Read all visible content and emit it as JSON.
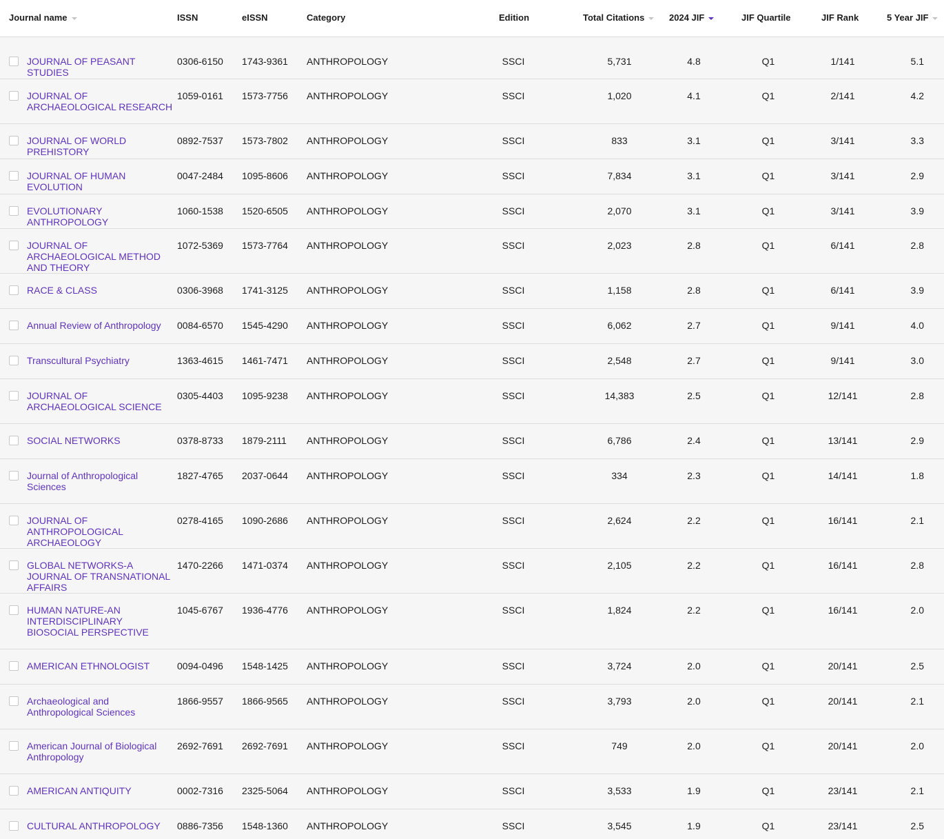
{
  "headers": {
    "journal_name": "Journal name",
    "issn": "ISSN",
    "eissn": "eISSN",
    "category": "Category",
    "edition": "Edition",
    "total_citations": "Total Citations",
    "jif": "2024 JIF",
    "jif_quartile": "JIF Quartile",
    "jif_rank": "JIF Rank",
    "five_year_jif": "5 Year JIF"
  },
  "colors": {
    "link": "#5e33bf",
    "active_sort": "#5e33bf",
    "row_bg": "#f6f6f6",
    "header_bg": "#ffffff",
    "divider": "#dcdcdc"
  },
  "rows": [
    {
      "name": "JOURNAL OF PEASANT STUDIES",
      "issn": "0306-6150",
      "eissn": "1743-9361",
      "category": "ANTHROPOLOGY",
      "edition": "SSCI",
      "citations": "5,731",
      "jif": "4.8",
      "quartile": "Q1",
      "rank": "1/141",
      "jif5": "5.1"
    },
    {
      "name": "JOURNAL OF ARCHAEOLOGICAL RESEARCH",
      "issn": "1059-0161",
      "eissn": "1573-7756",
      "category": "ANTHROPOLOGY",
      "edition": "SSCI",
      "citations": "1,020",
      "jif": "4.1",
      "quartile": "Q1",
      "rank": "2/141",
      "jif5": "4.2"
    },
    {
      "name": "JOURNAL OF WORLD PREHISTORY",
      "issn": "0892-7537",
      "eissn": "1573-7802",
      "category": "ANTHROPOLOGY",
      "edition": "SSCI",
      "citations": "833",
      "jif": "3.1",
      "quartile": "Q1",
      "rank": "3/141",
      "jif5": "3.3"
    },
    {
      "name": "JOURNAL OF HUMAN EVOLUTION",
      "issn": "0047-2484",
      "eissn": "1095-8606",
      "category": "ANTHROPOLOGY",
      "edition": "SSCI",
      "citations": "7,834",
      "jif": "3.1",
      "quartile": "Q1",
      "rank": "3/141",
      "jif5": "2.9"
    },
    {
      "name": "EVOLUTIONARY ANTHROPOLOGY",
      "issn": "1060-1538",
      "eissn": "1520-6505",
      "category": "ANTHROPOLOGY",
      "edition": "SSCI",
      "citations": "2,070",
      "jif": "3.1",
      "quartile": "Q1",
      "rank": "3/141",
      "jif5": "3.9"
    },
    {
      "name": "JOURNAL OF ARCHAEOLOGICAL METHOD AND THEORY",
      "issn": "1072-5369",
      "eissn": "1573-7764",
      "category": "ANTHROPOLOGY",
      "edition": "SSCI",
      "citations": "2,023",
      "jif": "2.8",
      "quartile": "Q1",
      "rank": "6/141",
      "jif5": "2.8"
    },
    {
      "name": "RACE & CLASS",
      "issn": "0306-3968",
      "eissn": "1741-3125",
      "category": "ANTHROPOLOGY",
      "edition": "SSCI",
      "citations": "1,158",
      "jif": "2.8",
      "quartile": "Q1",
      "rank": "6/141",
      "jif5": "3.9"
    },
    {
      "name": "Annual Review of Anthropology",
      "issn": "0084-6570",
      "eissn": "1545-4290",
      "category": "ANTHROPOLOGY",
      "edition": "SSCI",
      "citations": "6,062",
      "jif": "2.7",
      "quartile": "Q1",
      "rank": "9/141",
      "jif5": "4.0"
    },
    {
      "name": "Transcultural Psychiatry",
      "issn": "1363-4615",
      "eissn": "1461-7471",
      "category": "ANTHROPOLOGY",
      "edition": "SSCI",
      "citations": "2,548",
      "jif": "2.7",
      "quartile": "Q1",
      "rank": "9/141",
      "jif5": "3.0"
    },
    {
      "name": "JOURNAL OF ARCHAEOLOGICAL SCIENCE",
      "issn": "0305-4403",
      "eissn": "1095-9238",
      "category": "ANTHROPOLOGY",
      "edition": "SSCI",
      "citations": "14,383",
      "jif": "2.5",
      "quartile": "Q1",
      "rank": "12/141",
      "jif5": "2.8"
    },
    {
      "name": "SOCIAL NETWORKS",
      "issn": "0378-8733",
      "eissn": "1879-2111",
      "category": "ANTHROPOLOGY",
      "edition": "SSCI",
      "citations": "6,786",
      "jif": "2.4",
      "quartile": "Q1",
      "rank": "13/141",
      "jif5": "2.9"
    },
    {
      "name": "Journal of Anthropological Sciences",
      "issn": "1827-4765",
      "eissn": "2037-0644",
      "category": "ANTHROPOLOGY",
      "edition": "SSCI",
      "citations": "334",
      "jif": "2.3",
      "quartile": "Q1",
      "rank": "14/141",
      "jif5": "1.8"
    },
    {
      "name": "JOURNAL OF ANTHROPOLOGICAL ARCHAEOLOGY",
      "issn": "0278-4165",
      "eissn": "1090-2686",
      "category": "ANTHROPOLOGY",
      "edition": "SSCI",
      "citations": "2,624",
      "jif": "2.2",
      "quartile": "Q1",
      "rank": "16/141",
      "jif5": "2.1"
    },
    {
      "name": "GLOBAL NETWORKS-A JOURNAL OF TRANSNATIONAL AFFAIRS",
      "issn": "1470-2266",
      "eissn": "1471-0374",
      "category": "ANTHROPOLOGY",
      "edition": "SSCI",
      "citations": "2,105",
      "jif": "2.2",
      "quartile": "Q1",
      "rank": "16/141",
      "jif5": "2.8"
    },
    {
      "name": "HUMAN NATURE-AN INTERDISCIPLINARY BIOSOCIAL PERSPECTIVE",
      "issn": "1045-6767",
      "eissn": "1936-4776",
      "category": "ANTHROPOLOGY",
      "edition": "SSCI",
      "citations": "1,824",
      "jif": "2.2",
      "quartile": "Q1",
      "rank": "16/141",
      "jif5": "2.0"
    },
    {
      "name": "AMERICAN ETHNOLOGIST",
      "issn": "0094-0496",
      "eissn": "1548-1425",
      "category": "ANTHROPOLOGY",
      "edition": "SSCI",
      "citations": "3,724",
      "jif": "2.0",
      "quartile": "Q1",
      "rank": "20/141",
      "jif5": "2.5"
    },
    {
      "name": "Archaeological and Anthropological Sciences",
      "issn": "1866-9557",
      "eissn": "1866-9565",
      "category": "ANTHROPOLOGY",
      "edition": "SSCI",
      "citations": "3,793",
      "jif": "2.0",
      "quartile": "Q1",
      "rank": "20/141",
      "jif5": "2.1"
    },
    {
      "name": "American Journal of Biological Anthropology",
      "issn": "2692-7691",
      "eissn": "2692-7691",
      "category": "ANTHROPOLOGY",
      "edition": "SSCI",
      "citations": "749",
      "jif": "2.0",
      "quartile": "Q1",
      "rank": "20/141",
      "jif5": "2.0"
    },
    {
      "name": "AMERICAN ANTIQUITY",
      "issn": "0002-7316",
      "eissn": "2325-5064",
      "category": "ANTHROPOLOGY",
      "edition": "SSCI",
      "citations": "3,533",
      "jif": "1.9",
      "quartile": "Q1",
      "rank": "23/141",
      "jif5": "2.1"
    },
    {
      "name": "CULTURAL ANTHROPOLOGY",
      "issn": "0886-7356",
      "eissn": "1548-1360",
      "category": "ANTHROPOLOGY",
      "edition": "SSCI",
      "citations": "3,545",
      "jif": "1.9",
      "quartile": "Q1",
      "rank": "23/141",
      "jif5": "2.5"
    }
  ]
}
